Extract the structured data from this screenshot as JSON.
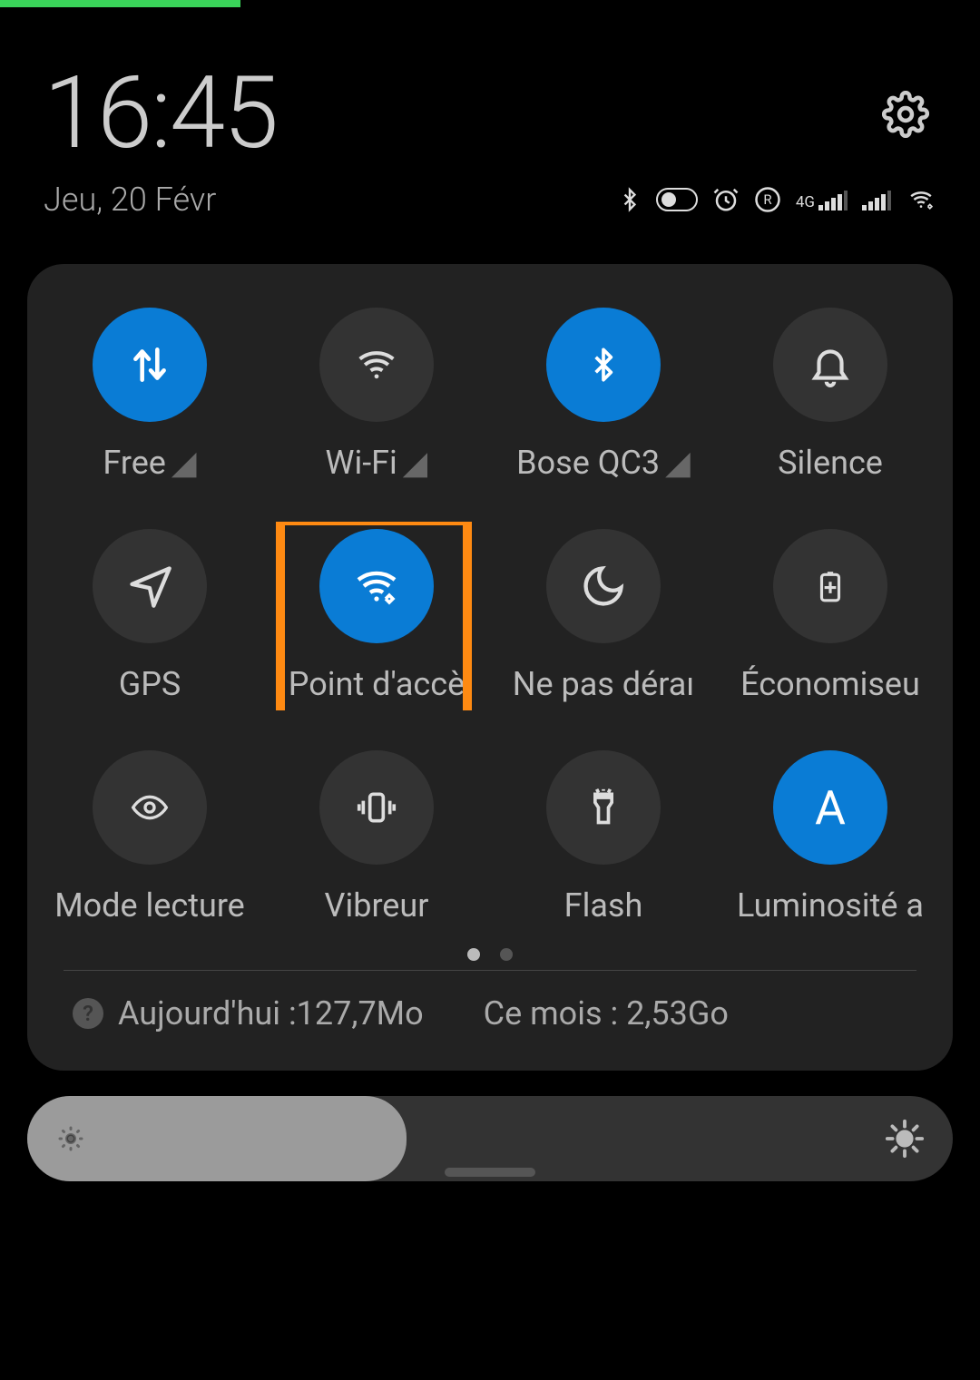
{
  "header": {
    "time": "16:45",
    "date": "Jeu, 20 Févr",
    "network_type": "4G"
  },
  "tiles": [
    {
      "label": "Free",
      "active": true,
      "icon": "data",
      "chevron": true
    },
    {
      "label": "Wi-Fi",
      "active": false,
      "icon": "wifi",
      "chevron": true
    },
    {
      "label": "Bose QC3",
      "active": true,
      "icon": "bluetooth",
      "chevron": true
    },
    {
      "label": "Silence",
      "active": false,
      "icon": "bell",
      "chevron": false
    },
    {
      "label": "GPS",
      "active": false,
      "icon": "gps",
      "chevron": false
    },
    {
      "label": "Point d'accè",
      "active": true,
      "icon": "hotspot",
      "chevron": false,
      "highlight": true
    },
    {
      "label": "Ne pas déraı",
      "active": false,
      "icon": "moon",
      "chevron": false
    },
    {
      "label": "Économiseu",
      "active": false,
      "icon": "battery",
      "chevron": false
    },
    {
      "label": "Mode lecture",
      "active": false,
      "icon": "eye",
      "chevron": false
    },
    {
      "label": "Vibreur",
      "active": false,
      "icon": "vibrate",
      "chevron": false
    },
    {
      "label": "Flash",
      "active": false,
      "icon": "torch",
      "chevron": false
    },
    {
      "label": "Luminosité a",
      "active": true,
      "icon": "auto",
      "chevron": false
    }
  ],
  "usage": {
    "today_label": "Aujourd'hui :127,7Mo",
    "month_label": "Ce mois : 2,53Go"
  },
  "brightness": {
    "percent": 41
  }
}
